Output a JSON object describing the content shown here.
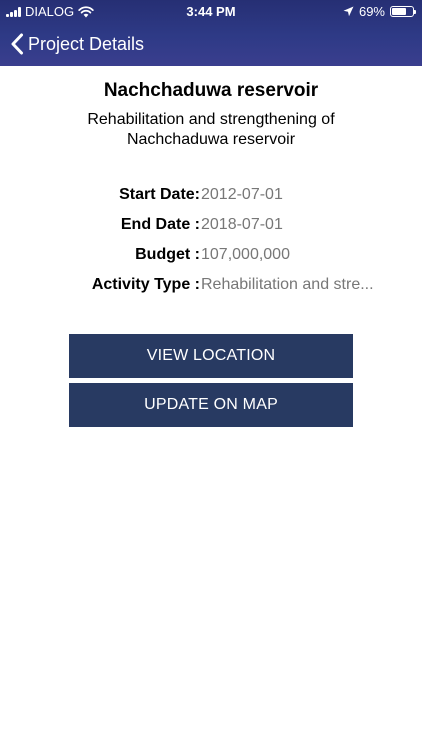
{
  "status_bar": {
    "carrier": "DIALOG",
    "time": "3:44 PM",
    "battery": "69%",
    "battery_level": 0.69
  },
  "nav": {
    "back_label": "Project Details"
  },
  "project": {
    "name": "Nachchaduwa reservoir",
    "description": "Rehabilitation and strengthening of Nachchaduwa reservoir",
    "fields": [
      {
        "label": "Start Date:",
        "value": "2012-07-01"
      },
      {
        "label": "End Date :",
        "value": "2018-07-01"
      },
      {
        "label": "Budget :",
        "value": "107,000,000"
      },
      {
        "label": "Activity Type :",
        "value": "Rehabilitation and stre..."
      }
    ]
  },
  "actions": {
    "view_location": "VIEW LOCATION",
    "update_on_map": "UPDATE ON MAP"
  },
  "colors": {
    "header": "#2e3a86",
    "button": "#283a62",
    "value_text": "#777777"
  }
}
